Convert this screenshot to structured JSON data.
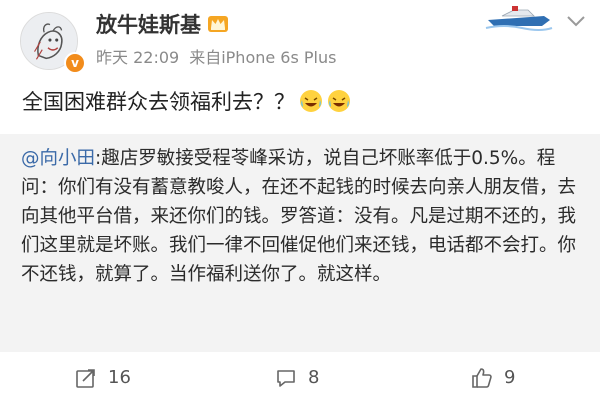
{
  "post": {
    "author": "放牛娃斯基",
    "time": "昨天 22:09",
    "source": "来自iPhone 6s Plus",
    "text": "全国困难群众去领福利去？？",
    "verified_mark": "v"
  },
  "repost": {
    "mention": "@向小田",
    "text": ":趣店罗敏接受程苓峰采访，说自己坏账率低于0.5%。程问：你们有没有蓄意教唆人，在还不起钱的时候去向亲人朋友借，去向其他平台借，来还你们的钱。罗答道：没有。凡是过期不还的，我们这里就是坏账。我们一律不回催促他们来还钱，电话都不会打。你不还钱，就算了。当作福利送你了。就这样。"
  },
  "actions": {
    "repost_count": "16",
    "comment_count": "8",
    "like_count": "9"
  },
  "icons": {
    "crown": "crown-icon",
    "laugh_cry": "laugh-cry-emoji-icon",
    "chevron": "chevron-down-icon",
    "repost": "repost-icon",
    "comment": "comment-icon",
    "like": "thumbs-up-icon"
  },
  "colors": {
    "mention": "#3b6aa8",
    "repost_bg": "#f3f3f3",
    "meta": "#8a8a8a",
    "verified": "#f28c1b"
  }
}
